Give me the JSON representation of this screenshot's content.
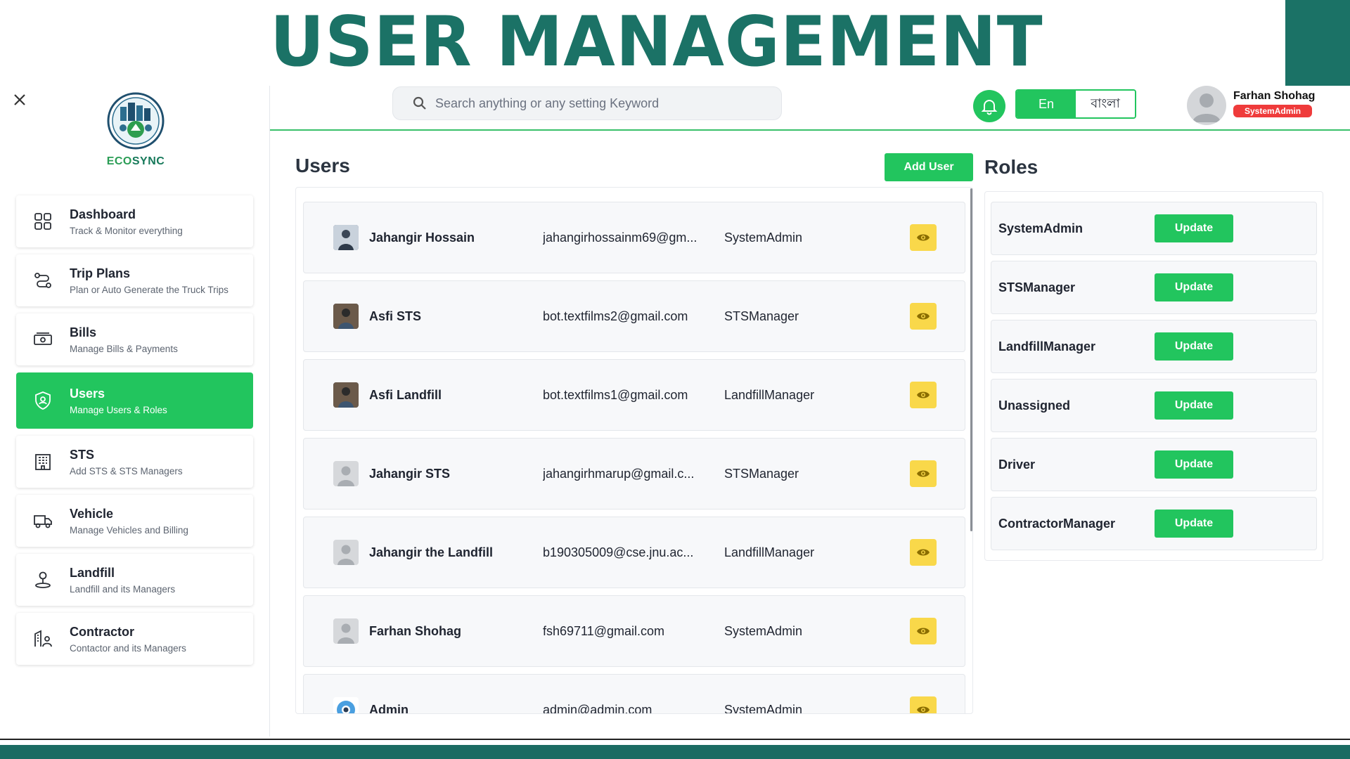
{
  "banner": {
    "title": "USER MANAGEMENT"
  },
  "logo": {
    "text_prefix": "ECO",
    "text_suffix": "SYNC"
  },
  "sidebar": {
    "items": [
      {
        "label": "Dashboard",
        "sub": "Track & Monitor everything",
        "icon": "dashboard-grid-icon",
        "active": false
      },
      {
        "label": "Trip Plans",
        "sub": "Plan or Auto Generate the Truck Trips",
        "icon": "route-icon",
        "active": false
      },
      {
        "label": "Bills",
        "sub": "Manage Bills & Payments",
        "icon": "cash-icon",
        "active": false
      },
      {
        "label": "Users",
        "sub": "Manage Users & Roles",
        "icon": "shield-user-icon",
        "active": true
      },
      {
        "label": "STS",
        "sub": "Add STS & STS Managers",
        "icon": "building-icon",
        "active": false
      },
      {
        "label": "Vehicle",
        "sub": "Manage Vehicles and Billing",
        "icon": "truck-icon",
        "active": false
      },
      {
        "label": "Landfill",
        "sub": "Landfill and its Managers",
        "icon": "person-pin-icon",
        "active": false
      },
      {
        "label": "Contractor",
        "sub": "Contactor and its Managers",
        "icon": "contractor-building-icon",
        "active": false
      }
    ]
  },
  "header": {
    "search_placeholder": "Search anything or any setting Keyword",
    "lang_en": "En",
    "lang_bn": "বাংলা",
    "user_name": "Farhan Shohag",
    "user_role": "SystemAdmin"
  },
  "users": {
    "title": "Users",
    "add_label": "Add User",
    "rows": [
      {
        "name": "Jahangir Hossain",
        "email": "jahangirhossainm69@gm...",
        "role": "SystemAdmin",
        "avatar": "photo"
      },
      {
        "name": "Asfi STS",
        "email": "bot.textfilms2@gmail.com",
        "role": "STSManager",
        "avatar": "photo"
      },
      {
        "name": "Asfi Landfill",
        "email": "bot.textfilms1@gmail.com",
        "role": "LandfillManager",
        "avatar": "photo"
      },
      {
        "name": "Jahangir STS",
        "email": "jahangirhmarup@gmail.c...",
        "role": "STSManager",
        "avatar": "placeholder"
      },
      {
        "name": "Jahangir the Landfill",
        "email": "b190305009@cse.jnu.ac...",
        "role": "LandfillManager",
        "avatar": "placeholder"
      },
      {
        "name": "Farhan Shohag",
        "email": "fsh69711@gmail.com",
        "role": "SystemAdmin",
        "avatar": "placeholder"
      },
      {
        "name": "Admin",
        "email": "admin@admin.com",
        "role": "SystemAdmin",
        "avatar": "gear"
      }
    ]
  },
  "roles": {
    "title": "Roles",
    "update_label": "Update",
    "rows": [
      "SystemAdmin",
      "STSManager",
      "LandfillManager",
      "Unassigned",
      "Driver",
      "ContractorManager"
    ]
  },
  "colors": {
    "brand": "#1b7266",
    "accent": "#22c55e",
    "badge": "#ef3b3b",
    "view_button": "#f9d84a"
  }
}
